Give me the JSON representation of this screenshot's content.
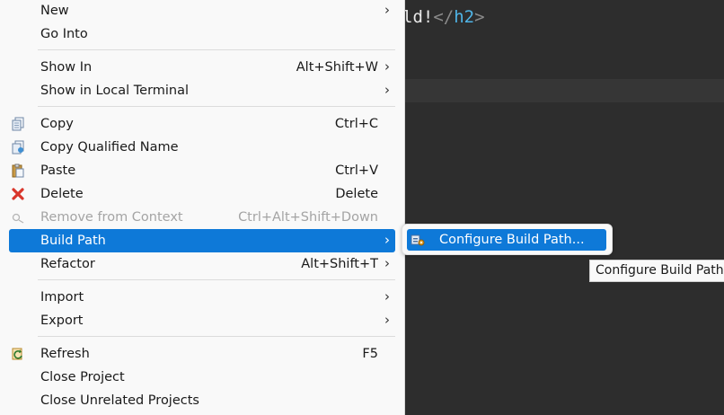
{
  "editor": {
    "code_visible": "ld!",
    "code_close_open": "</",
    "code_tag": "h2",
    "code_close_end": ">"
  },
  "menu": {
    "items": [
      {
        "label": "New",
        "accel": "",
        "has_submenu": true,
        "icon": ""
      },
      {
        "label": "Go Into",
        "accel": "",
        "has_submenu": false,
        "icon": ""
      },
      {
        "label": "Show In",
        "accel": "Alt+Shift+W",
        "has_submenu": true,
        "icon": ""
      },
      {
        "label": "Show in Local Terminal",
        "accel": "",
        "has_submenu": true,
        "icon": ""
      },
      {
        "label": "Copy",
        "accel": "Ctrl+C",
        "has_submenu": false,
        "icon": "copy-icon"
      },
      {
        "label": "Copy Qualified Name",
        "accel": "",
        "has_submenu": false,
        "icon": "copy-qualified-name-icon"
      },
      {
        "label": "Paste",
        "accel": "Ctrl+V",
        "has_submenu": false,
        "icon": "paste-icon"
      },
      {
        "label": "Delete",
        "accel": "Delete",
        "has_submenu": false,
        "icon": "delete-icon"
      },
      {
        "label": "Remove from Context",
        "accel": "Ctrl+Alt+Shift+Down",
        "has_submenu": false,
        "icon": "remove-context-icon",
        "disabled": true
      },
      {
        "label": "Build Path",
        "accel": "",
        "has_submenu": true,
        "icon": "",
        "selected": true
      },
      {
        "label": "Refactor",
        "accel": "Alt+Shift+T",
        "has_submenu": true,
        "icon": ""
      },
      {
        "label": "Import",
        "accel": "",
        "has_submenu": true,
        "icon": ""
      },
      {
        "label": "Export",
        "accel": "",
        "has_submenu": true,
        "icon": ""
      },
      {
        "label": "Refresh",
        "accel": "F5",
        "has_submenu": false,
        "icon": "refresh-icon"
      },
      {
        "label": "Close Project",
        "accel": "",
        "has_submenu": false,
        "icon": ""
      },
      {
        "label": "Close Unrelated Projects",
        "accel": "",
        "has_submenu": false,
        "icon": ""
      }
    ],
    "submenu_arrow": "›"
  },
  "submenu": {
    "items": [
      {
        "label": "Configure Build Path...",
        "icon": "configure-build-path-icon",
        "selected": true
      }
    ]
  },
  "tooltip": {
    "text": "Configure Build Path"
  },
  "colors": {
    "selection": "#0e79d8",
    "menu_background": "#f9f9f9",
    "editor_background": "#2d2d2d",
    "delete_red": "#d9362b"
  }
}
